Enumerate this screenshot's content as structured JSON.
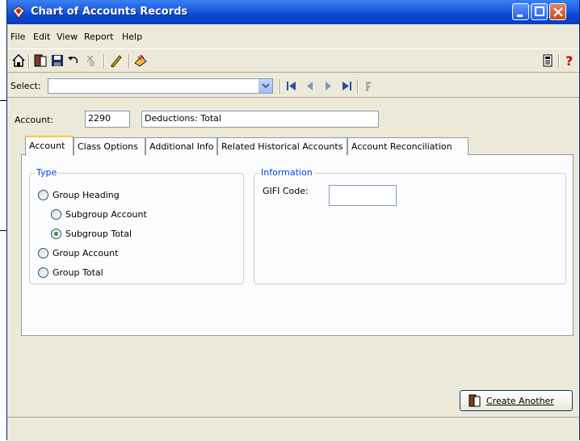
{
  "window": {
    "title": "Chart of Accounts Records"
  },
  "menu": [
    "File",
    "Edit",
    "View",
    "Report",
    "Help"
  ],
  "select": {
    "label": "Select:",
    "value": ""
  },
  "account": {
    "label": "Account:",
    "number": "2290",
    "name": "Deductions: Total"
  },
  "tabs": [
    "Account",
    "Class Options",
    "Additional Info",
    "Related Historical Accounts",
    "Account Reconciliation"
  ],
  "type_group": {
    "title": "Type",
    "options": [
      "Group Heading",
      "Subgroup Account",
      "Subgroup Total",
      "Group Account",
      "Group Total"
    ],
    "selected": "Subgroup Total"
  },
  "info_group": {
    "title": "Information",
    "gifi_label": "GIFI Code:",
    "gifi_value": ""
  },
  "create_button": "Create Another",
  "icons": {
    "toolbar": [
      "home-icon",
      "open-icon",
      "save-icon",
      "undo-icon",
      "remove-icon",
      "edit-icon",
      "lookup-icon",
      "calculator-icon",
      "help-icon"
    ],
    "navigation": [
      "first-record-icon",
      "previous-record-icon",
      "next-record-icon",
      "last-record-icon",
      "more-icon"
    ]
  },
  "colors": {
    "titlebar": "#0a49d6",
    "accent": "#0046d5",
    "tab_highlight": "#ffc83c",
    "help": "#cc0000"
  }
}
